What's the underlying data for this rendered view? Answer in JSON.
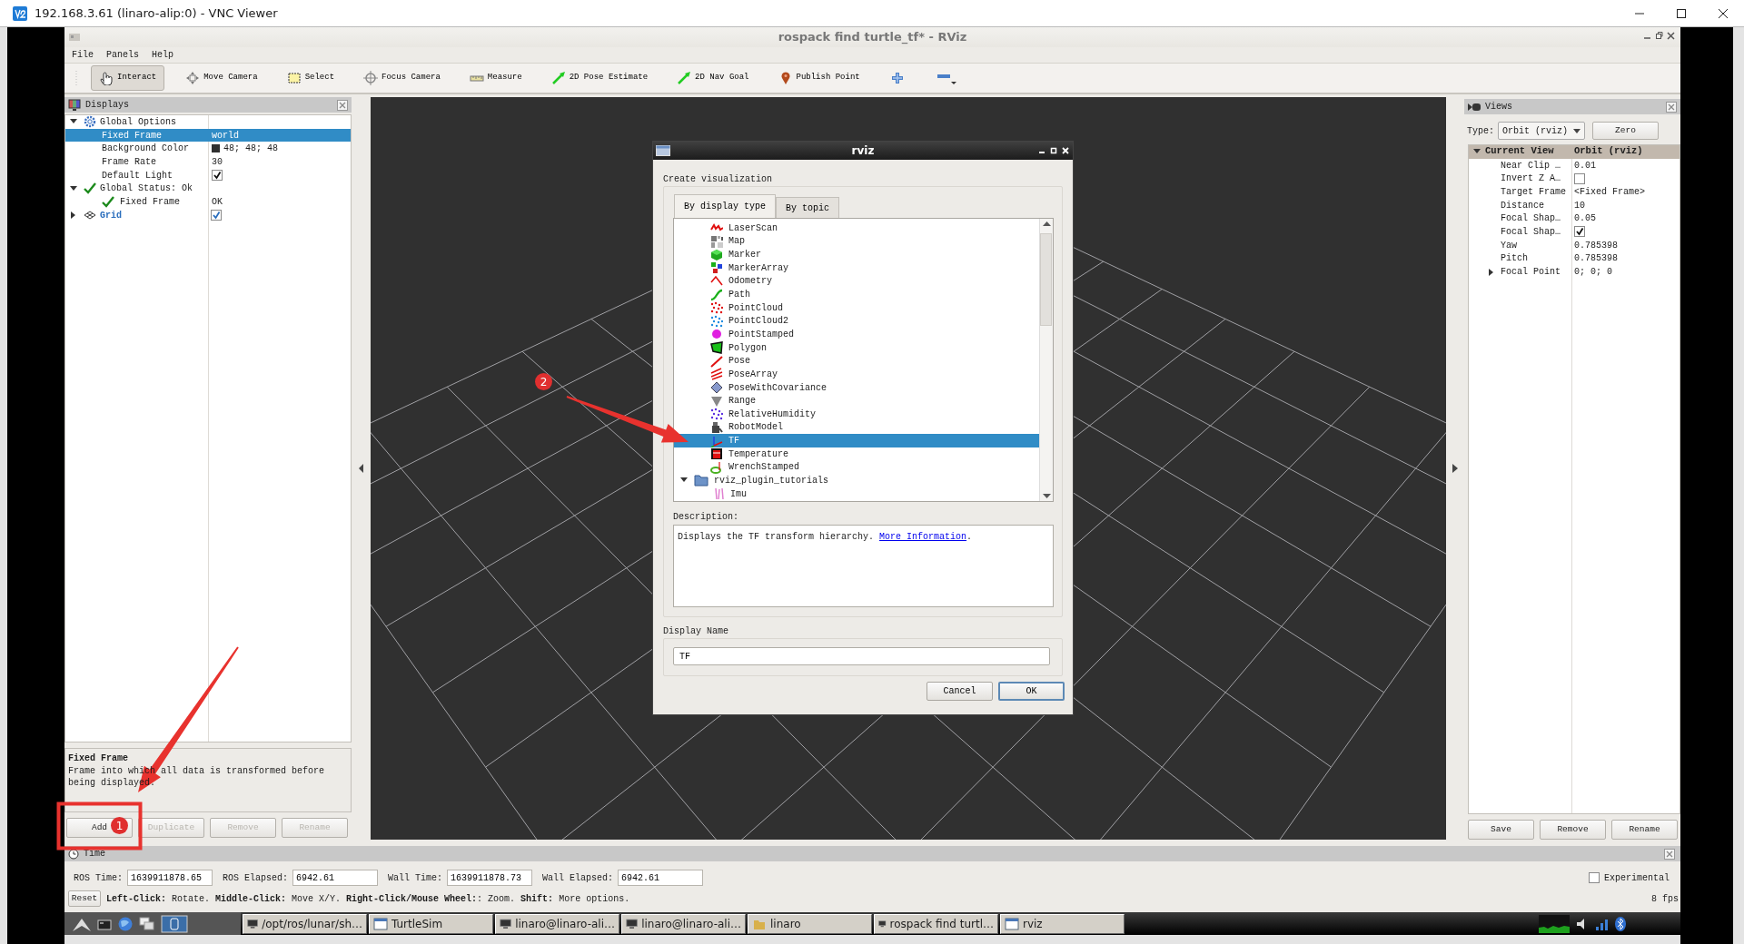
{
  "vnc_window": {
    "title": "192.168.3.61 (linaro-alip:0) - VNC Viewer"
  },
  "rviz_window": {
    "title": "rospack find turtle_tf* - RViz"
  },
  "menu": [
    {
      "label": "File"
    },
    {
      "label": "Panels"
    },
    {
      "label": "Help"
    }
  ],
  "toolbar": [
    {
      "label": "Interact",
      "selected": true
    },
    {
      "label": "Move Camera",
      "selected": false
    },
    {
      "label": "Select",
      "selected": false
    },
    {
      "label": "Focus Camera",
      "selected": false
    },
    {
      "label": "Measure",
      "selected": false
    },
    {
      "label": "2D Pose Estimate",
      "selected": false
    },
    {
      "label": "2D Nav Goal",
      "selected": false
    },
    {
      "label": "Publish Point",
      "selected": false
    }
  ],
  "displays": {
    "title": "Displays",
    "tree": [
      {
        "kind": "options",
        "label": "Global Options",
        "expanded": true,
        "selected": false,
        "children": [
          {
            "kind": "text",
            "label": "Fixed Frame",
            "value": "world",
            "selected": true
          },
          {
            "kind": "color",
            "label": "Background Color",
            "value": "48; 48; 48",
            "color": "#303030",
            "selected": false
          },
          {
            "kind": "text",
            "label": "Frame Rate",
            "value": "30",
            "selected": false
          },
          {
            "kind": "checkbox",
            "label": "Default Light",
            "checked": true,
            "selected": false
          }
        ]
      },
      {
        "kind": "status",
        "label": "Global Status: Ok",
        "expanded": true,
        "selected": false,
        "children": [
          {
            "kind": "status",
            "label": "Fixed Frame",
            "value": "OK",
            "selected": false
          }
        ]
      },
      {
        "kind": "display",
        "label": "Grid",
        "expanded": false,
        "checked": true,
        "selected": false
      }
    ],
    "description": {
      "title": "Fixed Frame",
      "text": "Frame into which all data is transformed before being displayed."
    },
    "buttons": [
      {
        "label": "Add",
        "disabled": false
      },
      {
        "label": "Duplicate",
        "disabled": true
      },
      {
        "label": "Remove",
        "disabled": true
      },
      {
        "label": "Rename",
        "disabled": true
      }
    ]
  },
  "views": {
    "title": "Views",
    "type_label": "Type:",
    "type_value": "Orbit (rviz)",
    "zero_button": "Zero",
    "tree": {
      "label": "Current View",
      "value": "Orbit (rviz)",
      "expanded": true,
      "children": [
        {
          "kind": "text",
          "label": "Near Clip …",
          "value": "0.01"
        },
        {
          "kind": "checkbox",
          "label": "Invert Z A…",
          "checked": false
        },
        {
          "kind": "text",
          "label": "Target Frame",
          "value": "<Fixed Frame>"
        },
        {
          "kind": "text",
          "label": "Distance",
          "value": "10"
        },
        {
          "kind": "text",
          "label": "Focal Shap…",
          "value": "0.05"
        },
        {
          "kind": "checkbox",
          "label": "Focal Shap…",
          "checked": true
        },
        {
          "kind": "text",
          "label": "Yaw",
          "value": "0.785398"
        },
        {
          "kind": "text",
          "label": "Pitch",
          "value": "0.785398"
        },
        {
          "kind": "group",
          "label": "Focal Point",
          "value": "0; 0; 0",
          "expanded": false
        }
      ]
    },
    "buttons": [
      {
        "label": "Save"
      },
      {
        "label": "Remove"
      },
      {
        "label": "Rename"
      }
    ]
  },
  "time": {
    "title": "Time",
    "fields": [
      {
        "label": "ROS Time:",
        "value": "1639911878.65"
      },
      {
        "label": "ROS Elapsed:",
        "value": "6942.61"
      },
      {
        "label": "Wall Time:",
        "value": "1639911878.73"
      },
      {
        "label": "Wall Elapsed:",
        "value": "6942.61"
      }
    ],
    "experimental": {
      "label": "Experimental",
      "checked": false
    },
    "reset_button": "Reset",
    "hint": "**Left-Click:** Rotate. **Middle-Click:** Move X/Y. **Right-Click/Mouse Wheel:**: Zoom. **Shift:** More options.",
    "fps": "8 fps"
  },
  "taskbar": {
    "windows": [
      {
        "label": "/opt/ros/lunar/sh…"
      },
      {
        "label": "TurtleSim"
      },
      {
        "label": "linaro@linaro-ali…"
      },
      {
        "label": "linaro@linaro-ali…"
      },
      {
        "label": "linaro"
      },
      {
        "label": "rospack find turtl…"
      },
      {
        "label": "rviz"
      }
    ]
  },
  "dialog": {
    "title": "rviz",
    "heading": "Create visualization",
    "tabs": [
      {
        "label": "By display type",
        "selected": true
      },
      {
        "label": "By topic",
        "selected": false
      }
    ],
    "types": [
      {
        "label": "LaserScan",
        "selected": false
      },
      {
        "label": "Map",
        "selected": false
      },
      {
        "label": "Marker",
        "selected": false
      },
      {
        "label": "MarkerArray",
        "selected": false
      },
      {
        "label": "Odometry",
        "selected": false
      },
      {
        "label": "Path",
        "selected": false
      },
      {
        "label": "PointCloud",
        "selected": false
      },
      {
        "label": "PointCloud2",
        "selected": false
      },
      {
        "label": "PointStamped",
        "selected": false
      },
      {
        "label": "Polygon",
        "selected": false
      },
      {
        "label": "Pose",
        "selected": false
      },
      {
        "label": "PoseArray",
        "selected": false
      },
      {
        "label": "PoseWithCovariance",
        "selected": false
      },
      {
        "label": "Range",
        "selected": false
      },
      {
        "label": "RelativeHumidity",
        "selected": false
      },
      {
        "label": "RobotModel",
        "selected": false
      },
      {
        "label": "TF",
        "selected": true
      },
      {
        "label": "Temperature",
        "selected": false
      },
      {
        "label": "WrenchStamped",
        "selected": false
      }
    ],
    "folder": {
      "label": "rviz_plugin_tutorials",
      "expanded": true,
      "children": [
        {
          "label": "Imu",
          "selected": false
        }
      ]
    },
    "description_label": "Description:",
    "description": "Displays the TF transform hierarchy. ",
    "link": "More Information",
    "description_end": ".",
    "display_name_label": "Display Name",
    "display_name": "TF",
    "buttons": [
      {
        "label": "Cancel",
        "default": false
      },
      {
        "label": "OK",
        "default": true
      }
    ]
  },
  "annotations": [
    {
      "number": "1"
    },
    {
      "number": "2"
    }
  ]
}
